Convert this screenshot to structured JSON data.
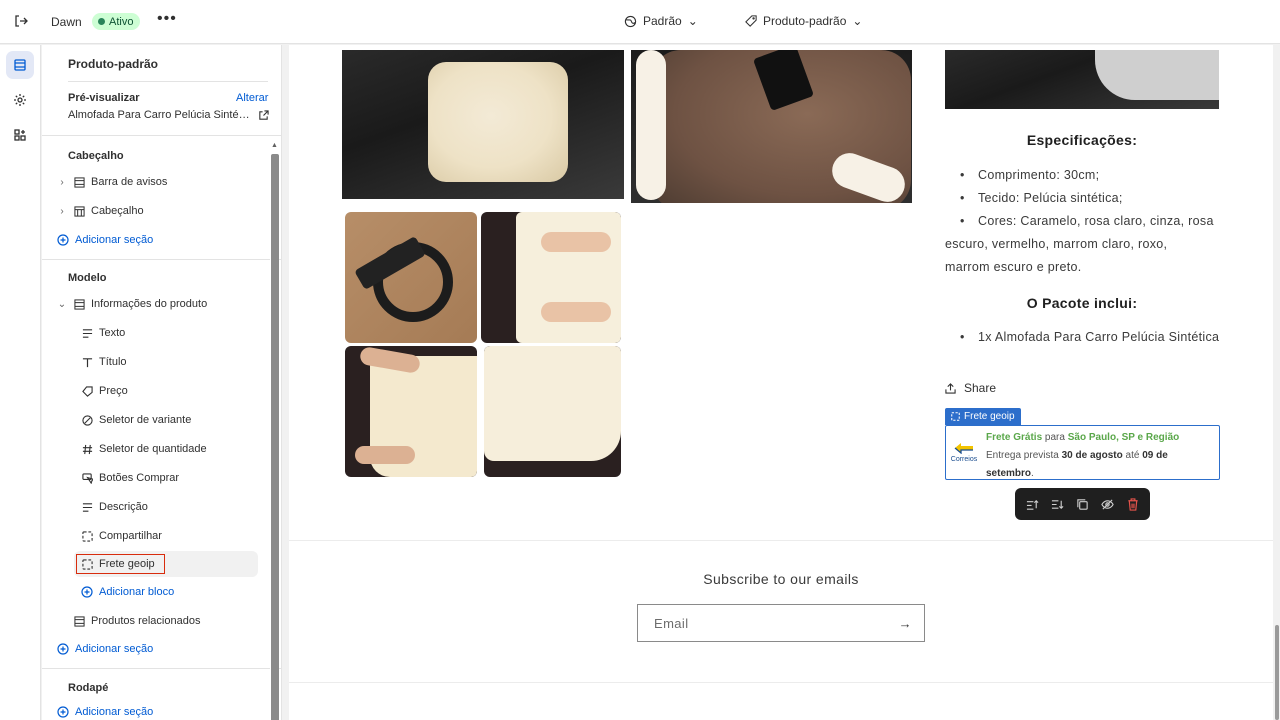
{
  "topbar": {
    "theme_name": "Dawn",
    "status": "Ativo",
    "more": "•••",
    "view_selector": "Padrão",
    "template_selector": "Produto-padrão"
  },
  "sidebar": {
    "title": "Produto-padrão",
    "preview_label": "Pré-visualizar",
    "preview_change": "Alterar",
    "preview_product": "Almofada Para Carro Pelúcia Sinté…",
    "header_group": {
      "title": "Cabeçalho",
      "items": [
        "Barra de avisos",
        "Cabeçalho"
      ],
      "add": "Adicionar seção"
    },
    "template_group": {
      "title": "Modelo",
      "section": "Informações do produto",
      "blocks": [
        "Texto",
        "Título",
        "Preço",
        "Seletor de variante",
        "Seletor de quantidade",
        "Botões Comprar",
        "Descrição",
        "Compartilhar",
        "Frete geoip"
      ],
      "add_block": "Adicionar bloco",
      "related": "Produtos relacionados",
      "add": "Adicionar seção"
    },
    "footer_group": {
      "title": "Rodapé",
      "add": "Adicionar seção"
    }
  },
  "product": {
    "spec_title": "Especificações:",
    "specs": [
      "Comprimento: 30cm;",
      "Tecido: Pelúcia sintética;",
      "Cores: Caramelo, rosa claro, cinza, rosa",
      "escuro, vermelho, marrom claro, roxo,",
      "marrom escuro e preto."
    ],
    "pack_title": "O Pacote inclui:",
    "pack_items": [
      "1x Almofada Para Carro Pelúcia Sintética"
    ],
    "share": "Share",
    "frete_tag": "Frete geoip",
    "frete": {
      "logo": "Correios",
      "free": "Frete Grátis",
      "for": " para ",
      "region": "São Paulo, SP e Região",
      "delivery": "Entrega prevista ",
      "date_from": "30 de agosto",
      "until": " até ",
      "date_to": "09 de setembro",
      "end": "."
    }
  },
  "newsletter": {
    "title": "Subscribe to our emails",
    "placeholder": "Email"
  }
}
